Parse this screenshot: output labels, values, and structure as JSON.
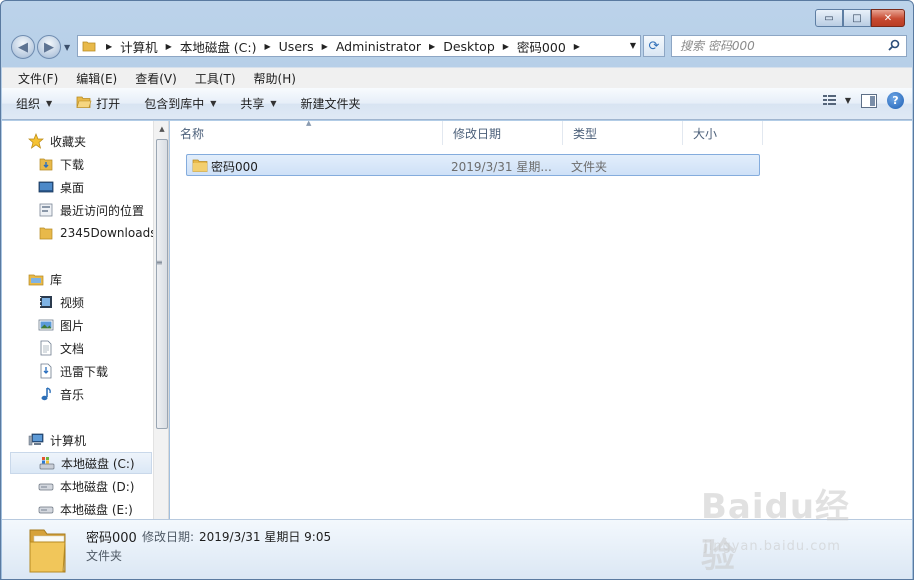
{
  "window": {
    "caption": {
      "minimize": "▭",
      "maximize": "□",
      "close": "✕"
    }
  },
  "nav": {
    "back": "◀",
    "forward": "▶",
    "history_drop": "▼"
  },
  "address": {
    "crumbs": [
      "计算机",
      "本地磁盘 (C:)",
      "Users",
      "Administrator",
      "Desktop",
      "密码000"
    ],
    "drop": "▼",
    "refresh": "⟳"
  },
  "search": {
    "placeholder": "搜索 密码000",
    "icon": "search-icon"
  },
  "menu": [
    "文件(F)",
    "编辑(E)",
    "查看(V)",
    "工具(T)",
    "帮助(H)"
  ],
  "commands": {
    "organize": "组织",
    "open": "打开",
    "include_in_library": "包含到库中",
    "share": "共享",
    "new_folder": "新建文件夹"
  },
  "navpane": {
    "favorites": {
      "header": "收藏夹",
      "items": [
        "下载",
        "桌面",
        "最近访问的位置",
        "2345Downloads"
      ]
    },
    "libraries": {
      "header": "库",
      "items": [
        "视频",
        "图片",
        "文档",
        "迅雷下载",
        "音乐"
      ]
    },
    "computer": {
      "header": "计算机",
      "items": [
        "本地磁盘 (C:)",
        "本地磁盘 (D:)",
        "本地磁盘 (E:)"
      ],
      "selected": "本地磁盘 (C:)"
    }
  },
  "columns": [
    "名称",
    "修改日期",
    "类型",
    "大小"
  ],
  "files": [
    {
      "name": "密码000",
      "modified": "2019/3/31 星期...",
      "type": "文件夹",
      "size": ""
    }
  ],
  "details": {
    "name": "密码000",
    "modified_label": "修改日期:",
    "modified_value": "2019/3/31 星期日 9:05",
    "type": "文件夹"
  },
  "watermark": {
    "line1": "Baidu经验",
    "line2": "jingyan.baidu.com"
  },
  "colors": {
    "folder": "#e8b94a",
    "selection": "#cfe1f7",
    "accent": "#1d5fb4"
  }
}
